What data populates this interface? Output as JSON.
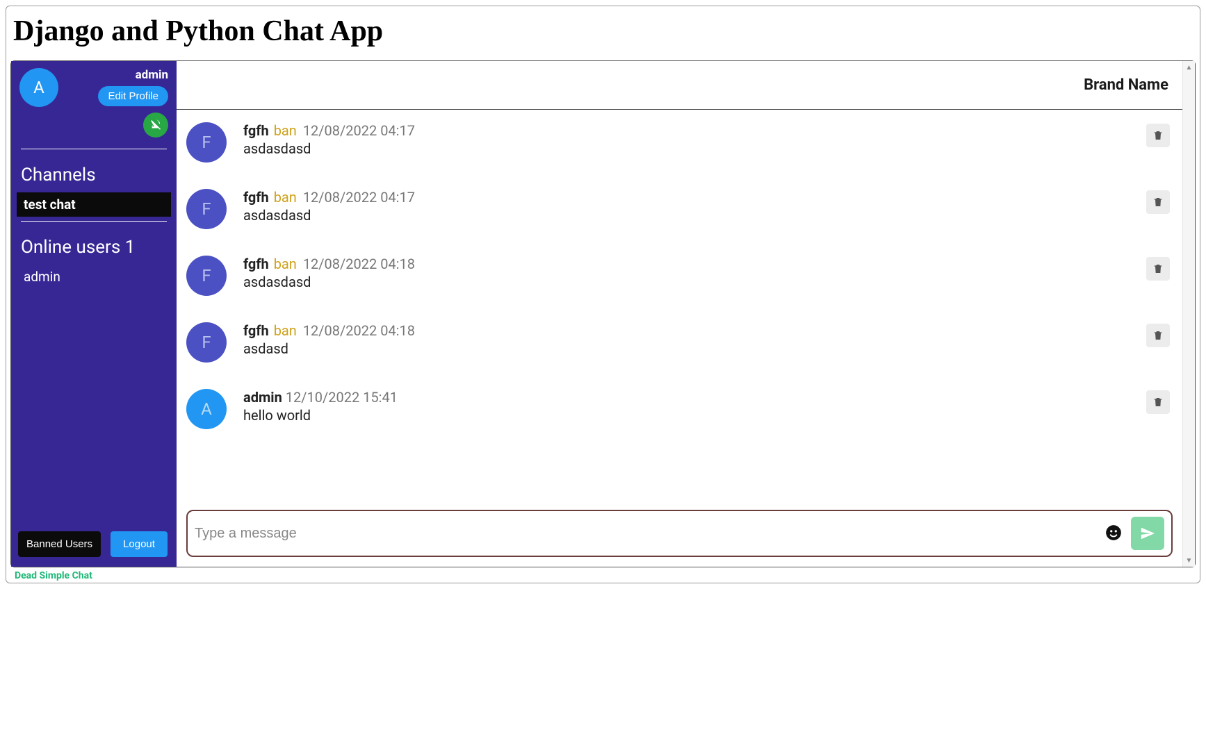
{
  "page_title": "Django and Python Chat App",
  "sidebar": {
    "avatar_letter": "A",
    "username": "admin",
    "edit_profile": "Edit Profile",
    "channels_label": "Channels",
    "channel_items": [
      "test chat"
    ],
    "online_label": "Online users 1",
    "online_users": [
      "admin"
    ],
    "banned_users_btn": "Banned Users",
    "logout_btn": "Logout"
  },
  "header": {
    "brand": "Brand Name"
  },
  "messages": [
    {
      "avatar": "F",
      "avatar_color": "purple",
      "user": "fgfh",
      "show_ban": true,
      "ban_label": "ban",
      "time": "12/08/2022 04:17",
      "text": "asdasdasd"
    },
    {
      "avatar": "F",
      "avatar_color": "purple",
      "user": "fgfh",
      "show_ban": true,
      "ban_label": "ban",
      "time": "12/08/2022 04:17",
      "text": "asdasdasd"
    },
    {
      "avatar": "F",
      "avatar_color": "purple",
      "user": "fgfh",
      "show_ban": true,
      "ban_label": "ban",
      "time": "12/08/2022 04:18",
      "text": "asdasdasd"
    },
    {
      "avatar": "F",
      "avatar_color": "purple",
      "user": "fgfh",
      "show_ban": true,
      "ban_label": "ban",
      "time": "12/08/2022 04:18",
      "text": "asdasd"
    },
    {
      "avatar": "A",
      "avatar_color": "blue",
      "user": "admin",
      "show_ban": false,
      "ban_label": "",
      "time": "12/10/2022 15:41",
      "text": "hello world"
    }
  ],
  "composer": {
    "placeholder": "Type a message"
  },
  "footer": {
    "link": "Dead Simple Chat"
  }
}
